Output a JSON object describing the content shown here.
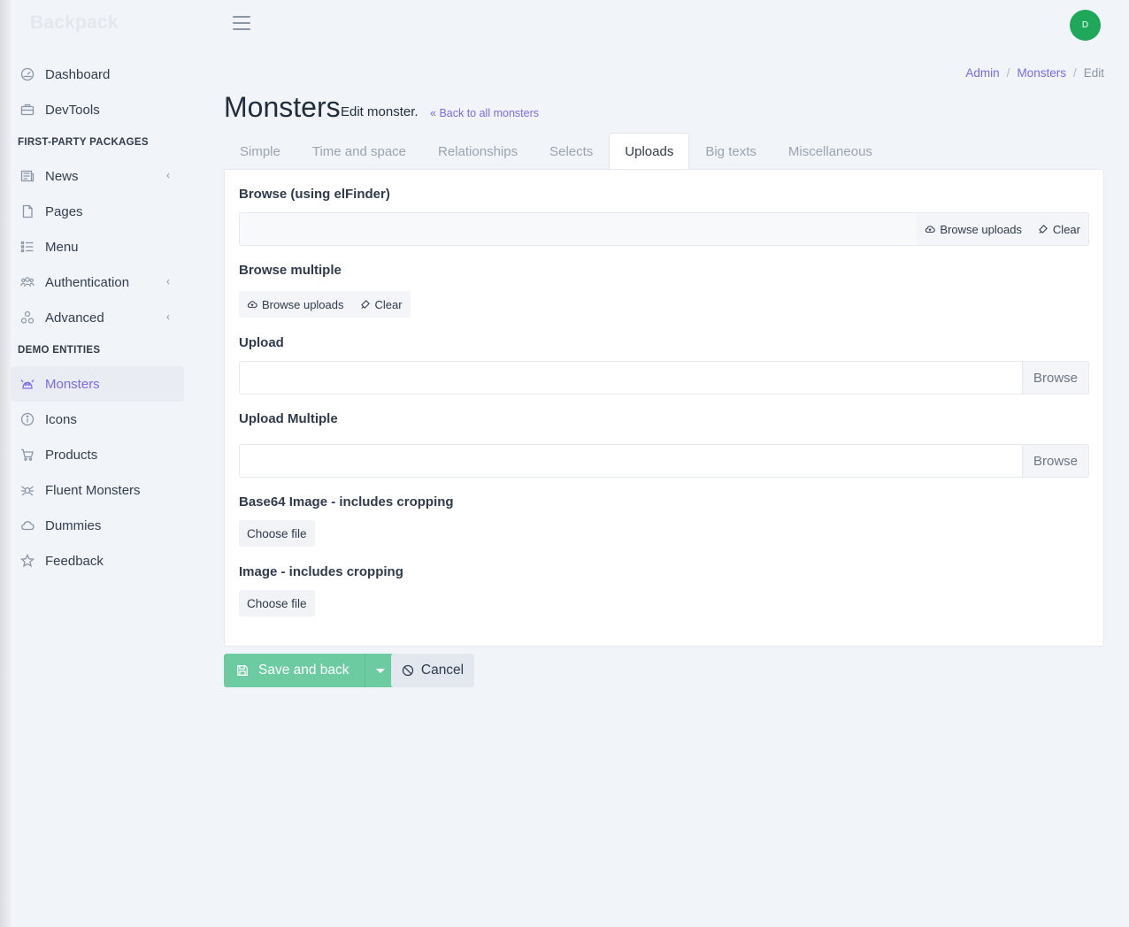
{
  "brand": "Backpack",
  "sidebar": {
    "top_items": [
      {
        "label": "Dashboard",
        "icon": "dashboard-icon"
      },
      {
        "label": "DevTools",
        "icon": "toolbox-icon"
      }
    ],
    "section1": "FIRST-PARTY PACKAGES",
    "pkg_items": [
      {
        "label": "News",
        "icon": "newspaper-icon",
        "chevron": "‹"
      },
      {
        "label": "Pages",
        "icon": "file-icon"
      },
      {
        "label": "Menu",
        "icon": "list-icon"
      },
      {
        "label": "Authentication",
        "icon": "users-icon",
        "chevron": "‹"
      },
      {
        "label": "Advanced",
        "icon": "cogs-icon",
        "chevron": "‹"
      }
    ],
    "section2": "DEMO ENTITIES",
    "demo_items": [
      {
        "label": "Monsters",
        "icon": "monster-icon",
        "active": true
      },
      {
        "label": "Icons",
        "icon": "info-icon"
      },
      {
        "label": "Products",
        "icon": "cart-icon"
      },
      {
        "label": "Fluent Monsters",
        "icon": "spider-icon"
      },
      {
        "label": "Dummies",
        "icon": "cloud-icon"
      },
      {
        "label": "Feedback",
        "icon": "star-icon"
      }
    ]
  },
  "header": {
    "avatar_initial": "D"
  },
  "breadcrumb": {
    "items": [
      "Admin",
      "Monsters",
      "Edit"
    ],
    "sep": "/"
  },
  "page": {
    "title": "Monsters",
    "subtitle": "Edit monster.",
    "back_link": "Back to all monsters"
  },
  "tabs": [
    "Simple",
    "Time and space",
    "Relationships",
    "Selects",
    "Uploads",
    "Big texts",
    "Miscellaneous"
  ],
  "active_tab": "Uploads",
  "form": {
    "browse_label": "Browse (using elFinder)",
    "browse_uploads": "Browse uploads",
    "clear": "Clear",
    "browse_multiple_label": "Browse multiple",
    "upload_label": "Upload",
    "browse": "Browse",
    "upload_multiple_label": "Upload Multiple",
    "base64_label": "Base64 Image - includes cropping",
    "choose_file": "Choose file",
    "image_label": "Image - includes cropping"
  },
  "footer": {
    "save": "Save and back",
    "cancel": "Cancel"
  },
  "colors": {
    "accent": "#7c69ef",
    "success": "#6ccba0",
    "avatar": "#1fa85a"
  }
}
